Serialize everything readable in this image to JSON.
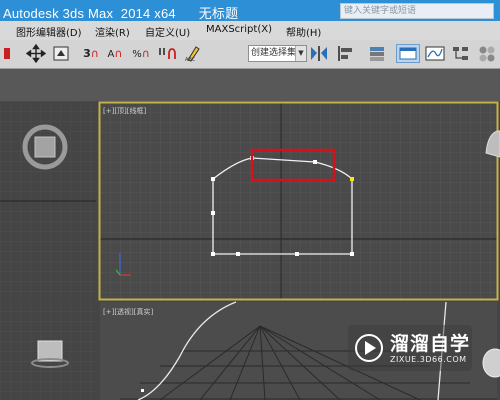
{
  "titlebar": {
    "app_title": "Autodesk 3ds Max  2014 x64      无标题",
    "search_placeholder": "键入关键字或短语"
  },
  "menubar": {
    "items": [
      "图形编辑器(D)",
      "渲染(R)",
      "自定义(U)",
      "MAXScript(X)",
      "帮助(H)"
    ]
  },
  "toolbar": {
    "snap_label": "3",
    "angle_snap_label": "A",
    "percent_snap_label": "%",
    "selection_set_value": "创建选择集"
  },
  "viewports": {
    "top_left_label": "[+][顶][线框]",
    "perspective_label": "[+][透视][真实]"
  },
  "watermark": {
    "text": "溜溜自学",
    "url": "ZIXUE.3D66.COM"
  },
  "colors": {
    "titlebar": "#2d8fd6",
    "viewport_border_active": "#c7b24a",
    "highlight_box": "#d4121b",
    "selected_vertex": "#f2e81a"
  }
}
